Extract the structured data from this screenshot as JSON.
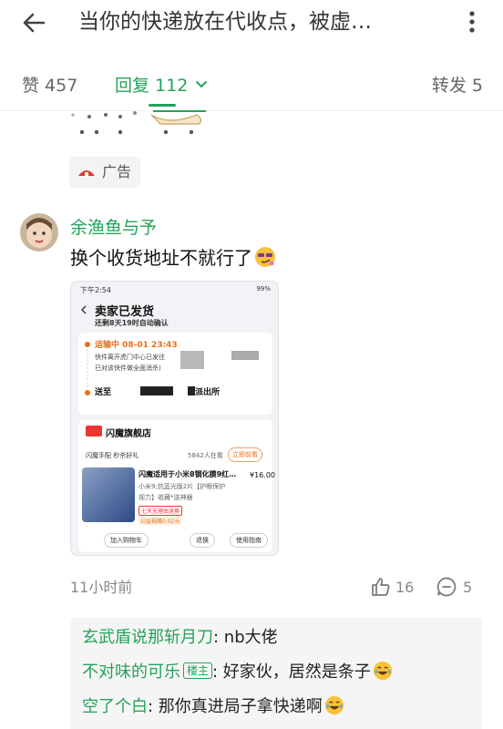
{
  "header": {
    "title": "当你的快递放在代收点，被虚…"
  },
  "tabs": {
    "like": "赞 457",
    "reply": "回复 112",
    "share": "转发 5"
  },
  "ad": {
    "label": "广告"
  },
  "comment": {
    "username": "余渔鱼与予",
    "text": "换个收货地址不就行了",
    "time": "11小时前",
    "likes": "16",
    "replies": "5"
  },
  "screenshot": {
    "status_time": "下午2:54",
    "status_right": "99%",
    "title": "卖家已发货",
    "subtitle": "还剩8天19时自动确认",
    "transit_tag": "运输中  08-01 23:43",
    "transit_line1": "快件离开虎门中心已发往",
    "transit_line2": "已对该快件做全面消杀)",
    "address_prefix": "送至",
    "address_suffix": "派出所",
    "shop_name": "闪魔旗舰店",
    "promo": "闪魔手配 秒杀好礼",
    "promo_count": "5842人在看",
    "promo_btn": "立即前看",
    "product_title": "闪魔适用于小米8钢化膜9红…",
    "product_price": "¥16.00",
    "product_desc1": "小米9;抗蓝光版2片【护眼保护",
    "product_desc2": "视力】收藏*送神器",
    "badge1": "七天无理由退换",
    "badge2": "公益捐赠0.02元",
    "btn_cart": "加入购物车",
    "btn_return": "退换",
    "btn_guide": "使用指南"
  },
  "sub_replies": [
    {
      "user": "玄武盾说那斩月刀",
      "text": ": nb大佬"
    },
    {
      "user": "不对味的可乐",
      "badge": "楼主",
      "text": ": 好家伙，居然是条子"
    },
    {
      "user": "空了个白",
      "text": ": 那你真进局子拿快递啊"
    }
  ],
  "colors": {
    "accent": "#23a35a",
    "text": "#222222",
    "muted": "#888888"
  },
  "icons": [
    "back-arrow-icon",
    "more-vertical-icon",
    "chevron-down-icon",
    "ad-logo-icon",
    "thumbs-up-icon",
    "reply-bubble-icon",
    "smirk-emoji-icon",
    "laugh-tears-emoji-icon"
  ]
}
